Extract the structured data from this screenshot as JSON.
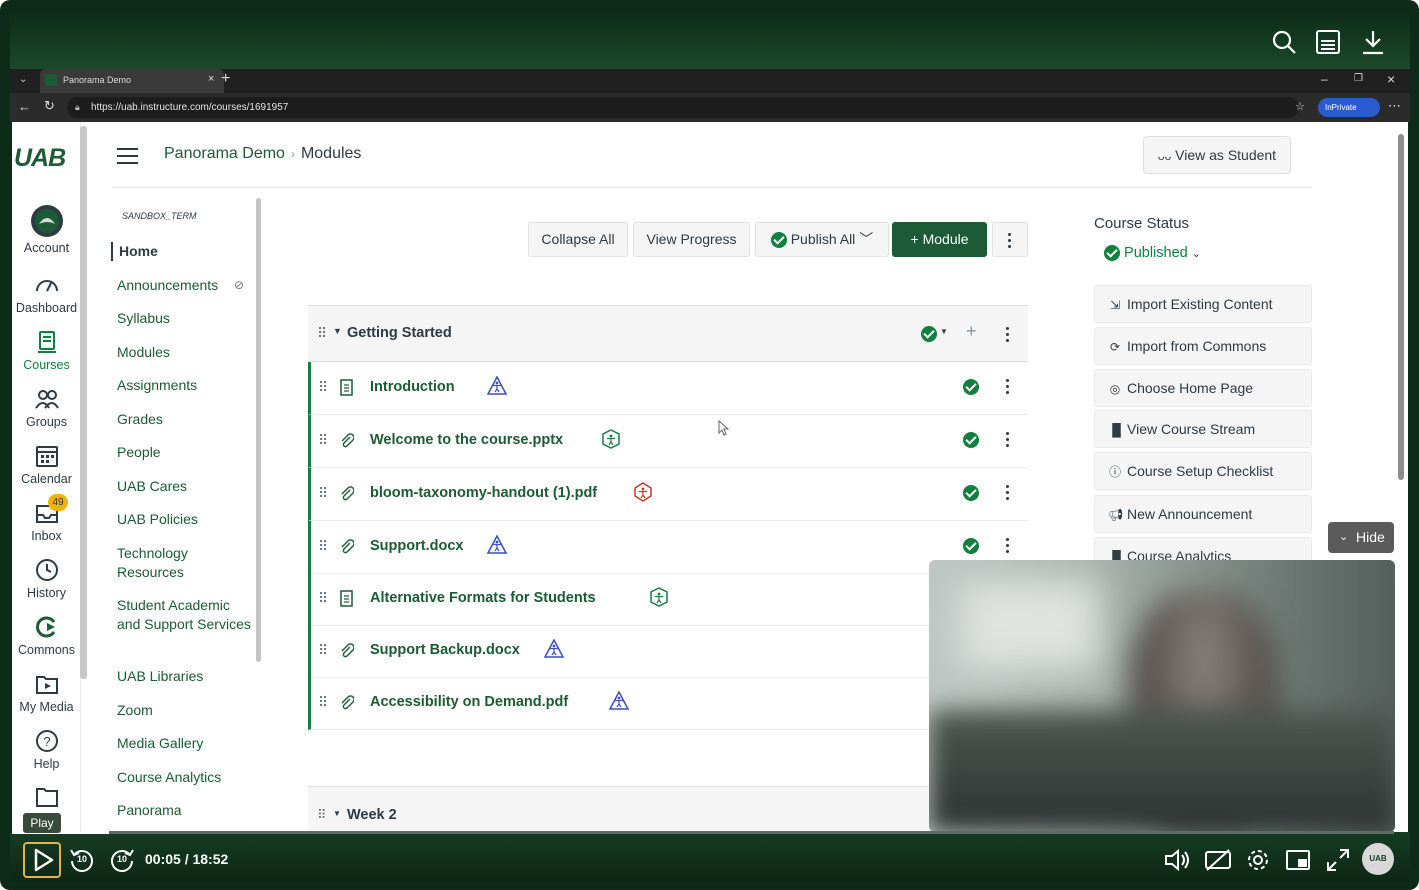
{
  "browser": {
    "tab_title": "Panorama Demo",
    "url": "https://uab.instructure.com/courses/1691957",
    "inprivate_label": "InPrivate"
  },
  "global_nav": {
    "logo": "UAB",
    "items": [
      {
        "label": "Account",
        "icon": "account-avatar-icon"
      },
      {
        "label": "Dashboard",
        "icon": "dashboard-icon"
      },
      {
        "label": "Courses",
        "icon": "courses-icon"
      },
      {
        "label": "Groups",
        "icon": "groups-icon"
      },
      {
        "label": "Calendar",
        "icon": "calendar-icon"
      },
      {
        "label": "Inbox",
        "icon": "inbox-icon",
        "badge": "49"
      },
      {
        "label": "History",
        "icon": "history-icon"
      },
      {
        "label": "Commons",
        "icon": "commons-icon"
      },
      {
        "label": "My Media",
        "icon": "my-media-icon"
      },
      {
        "label": "Help",
        "icon": "help-icon"
      }
    ]
  },
  "header": {
    "breadcrumb_course": "Panorama Demo",
    "breadcrumb_page": "Modules",
    "view_as_student": "View as Student"
  },
  "course_nav": {
    "term": "SANDBOX_TERM",
    "items": [
      {
        "label": "Home"
      },
      {
        "label": "Announcements"
      },
      {
        "label": "Syllabus"
      },
      {
        "label": "Modules"
      },
      {
        "label": "Assignments"
      },
      {
        "label": "Grades"
      },
      {
        "label": "People"
      },
      {
        "label": "UAB Cares"
      },
      {
        "label": "UAB Policies"
      },
      {
        "label": "Technology Resources"
      },
      {
        "label": "Student Academic and Support Services"
      },
      {
        "label": "UAB Libraries"
      },
      {
        "label": "Zoom"
      },
      {
        "label": "Media Gallery"
      },
      {
        "label": "Course Analytics"
      },
      {
        "label": "Panorama"
      }
    ]
  },
  "toolbar": {
    "collapse_all": "Collapse All",
    "view_progress": "View Progress",
    "publish_all": "Publish All",
    "add_module": "Module"
  },
  "module": {
    "title": "Getting Started",
    "items": [
      {
        "title": "Introduction",
        "type": "page-icon",
        "accessibility": "blue"
      },
      {
        "title": "Welcome to the course.pptx",
        "type": "attachment-icon",
        "accessibility": "green"
      },
      {
        "title": "bloom-taxonomy-handout (1).pdf",
        "type": "attachment-icon",
        "accessibility": "red"
      },
      {
        "title": "Support.docx",
        "type": "attachment-icon",
        "accessibility": "blue"
      },
      {
        "title": "Alternative Formats for Students",
        "type": "page-icon",
        "accessibility": "green"
      },
      {
        "title": "Support Backup.docx",
        "type": "attachment-icon",
        "accessibility": "blue"
      },
      {
        "title": "Accessibility on Demand.pdf",
        "type": "attachment-icon",
        "accessibility": "blue"
      }
    ],
    "next_module_title": "Week 2"
  },
  "sidebar": {
    "course_status_label": "Course Status",
    "status": "Published",
    "buttons": [
      {
        "label": "Import Existing Content",
        "icon": "import-icon"
      },
      {
        "label": "Import from Commons",
        "icon": "commons-icon"
      },
      {
        "label": "Choose Home Page",
        "icon": "target-icon"
      },
      {
        "label": "View Course Stream",
        "icon": "bar-chart-icon"
      },
      {
        "label": "Course Setup Checklist",
        "icon": "question-icon"
      },
      {
        "label": "New Announcement",
        "icon": "megaphone-icon"
      },
      {
        "label": "Course Analytics",
        "icon": "bar-chart-icon"
      }
    ]
  },
  "player": {
    "hide_label": "Hide",
    "play_tooltip": "Play",
    "time": "00:05 / 18:52",
    "skip_seconds": "10",
    "progress": 0.07,
    "brand": "UAB"
  },
  "colors": {
    "brand_green": "#1c5b35",
    "published_green": "#11803e",
    "accessibility_blue": "#3a4fb8",
    "accessibility_green": "#1e7a44",
    "accessibility_red": "#c0392b",
    "player_accent": "#e3b24d"
  }
}
